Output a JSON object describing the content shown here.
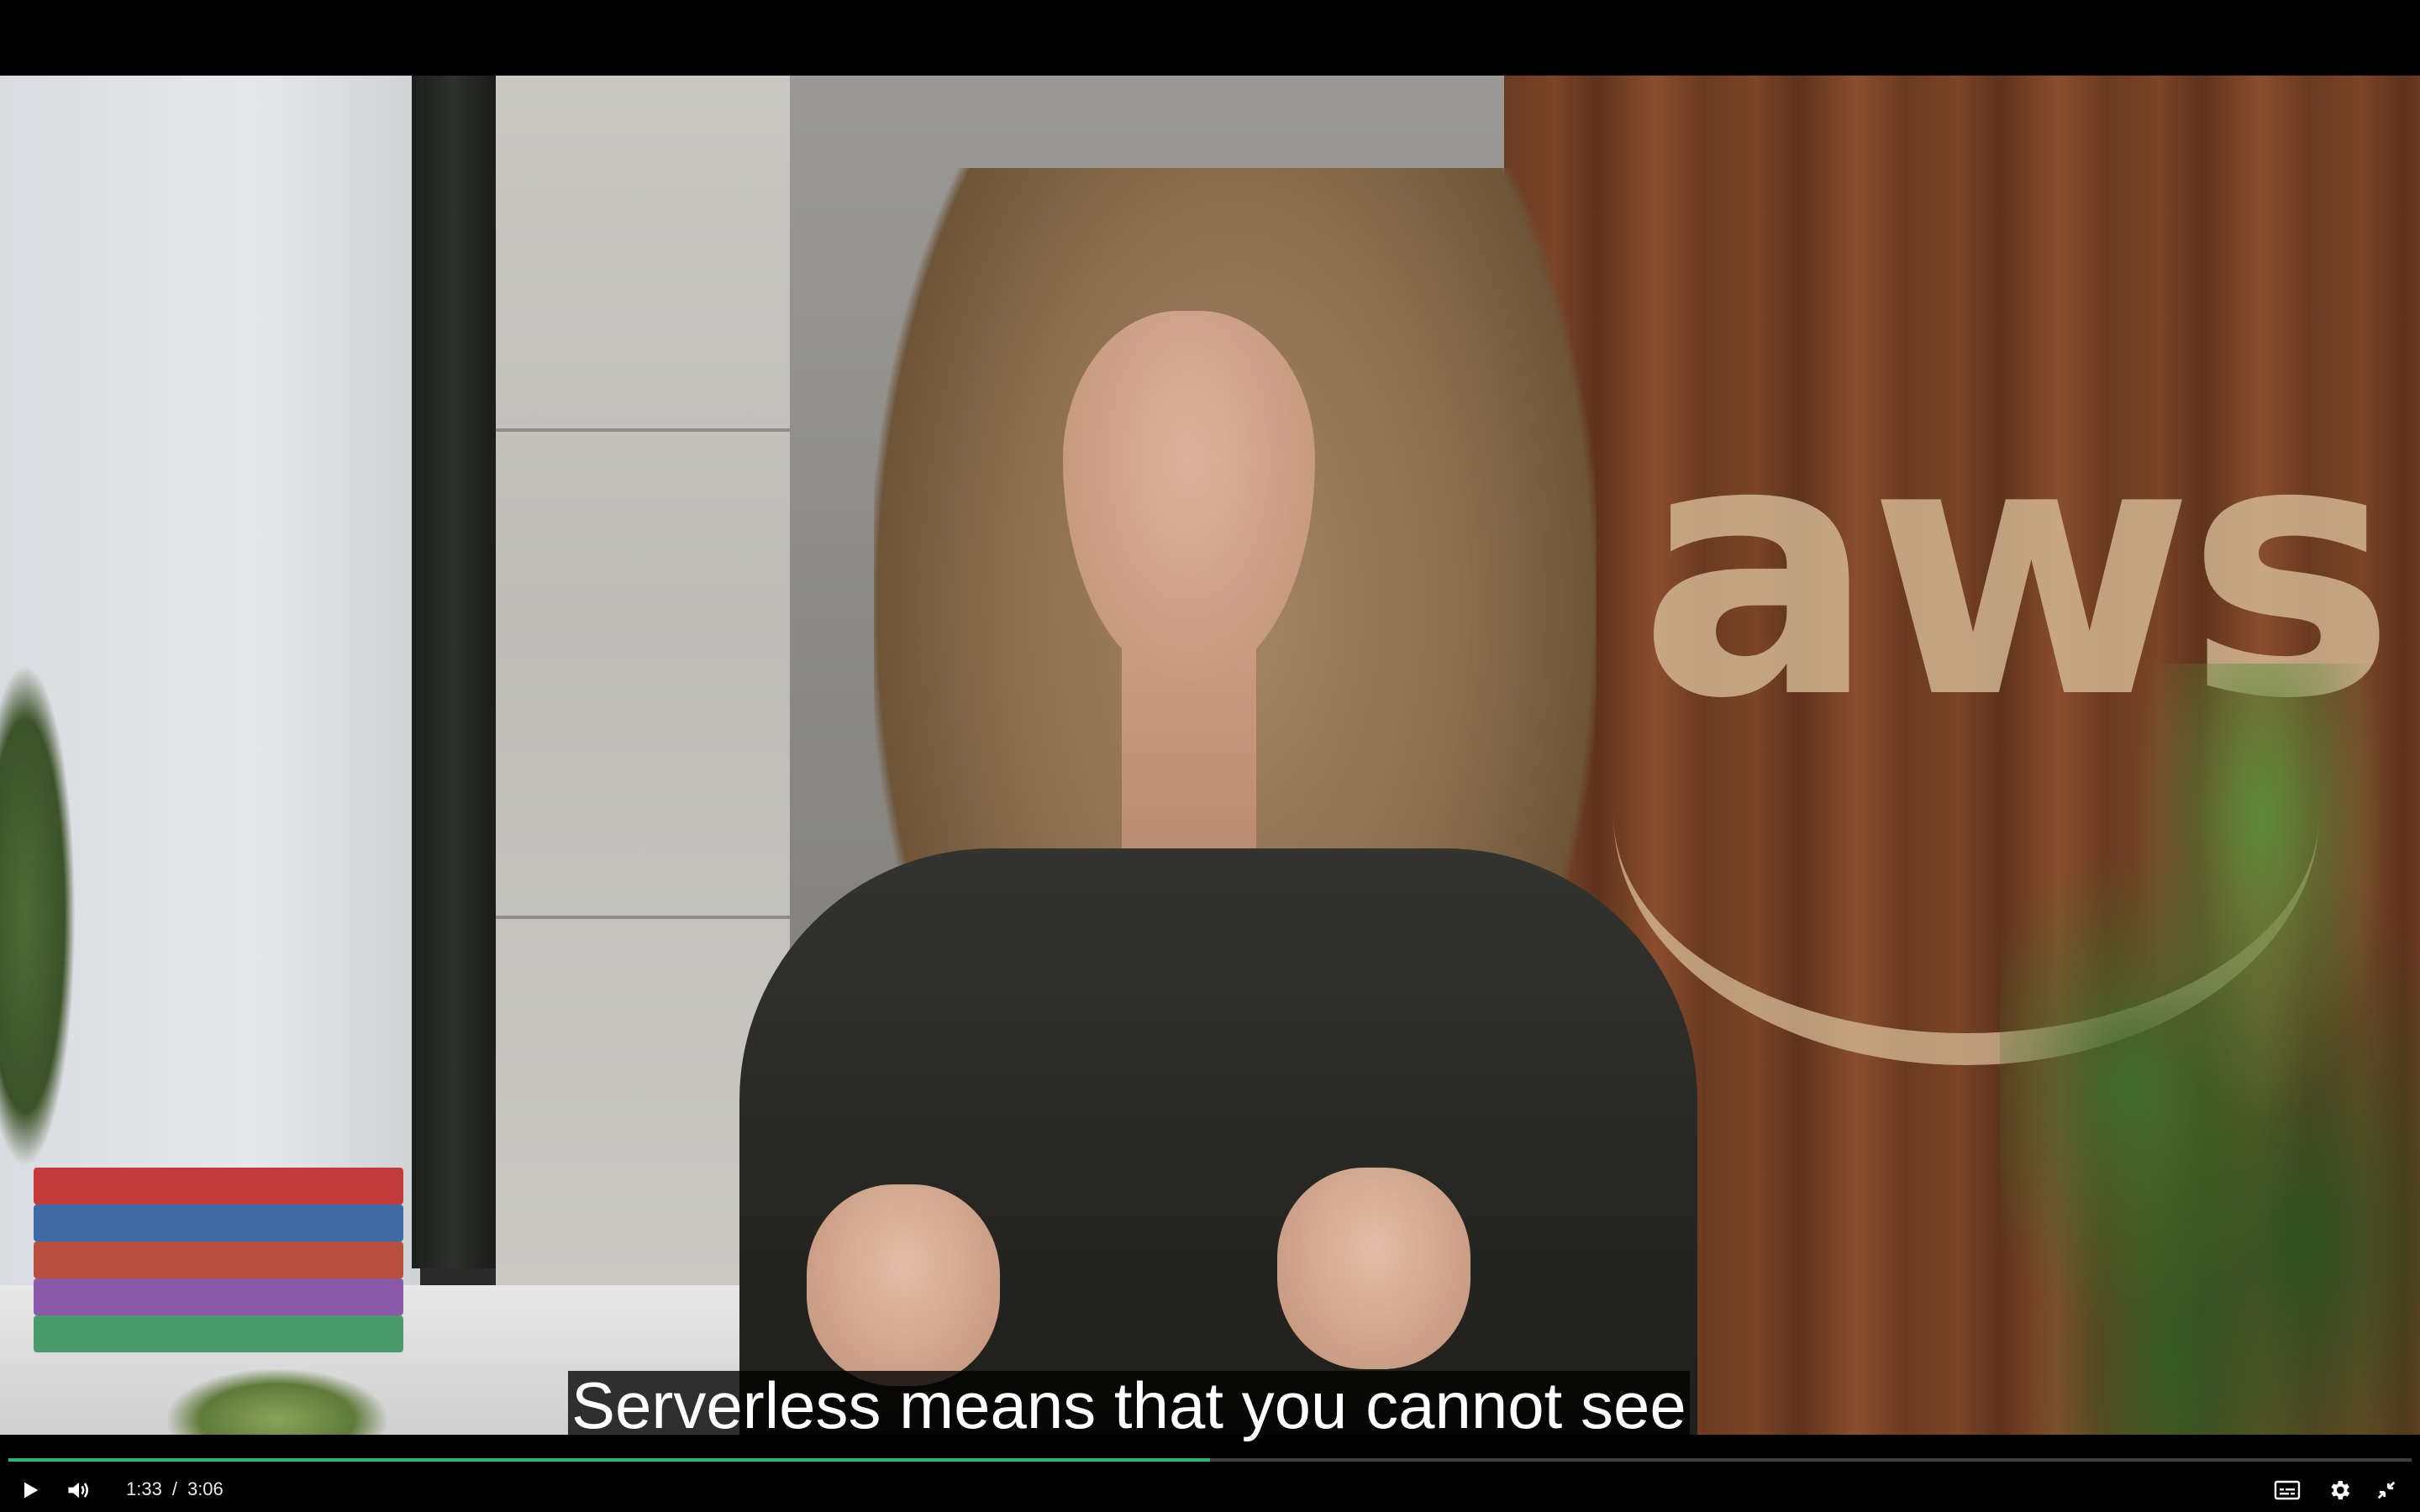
{
  "video": {
    "background_logo_text": "aws",
    "subtitle": "Serverless means that you cannot see"
  },
  "controls": {
    "current_time": "1:33",
    "separator": "/",
    "duration": "3:06",
    "progress_fraction": 0.5,
    "accent_color": "#2bb673",
    "icons": {
      "play": "play-icon",
      "volume": "volume-icon",
      "captions": "captions-icon",
      "settings": "gear-icon",
      "exit_fullscreen": "exit-fullscreen-icon"
    }
  }
}
